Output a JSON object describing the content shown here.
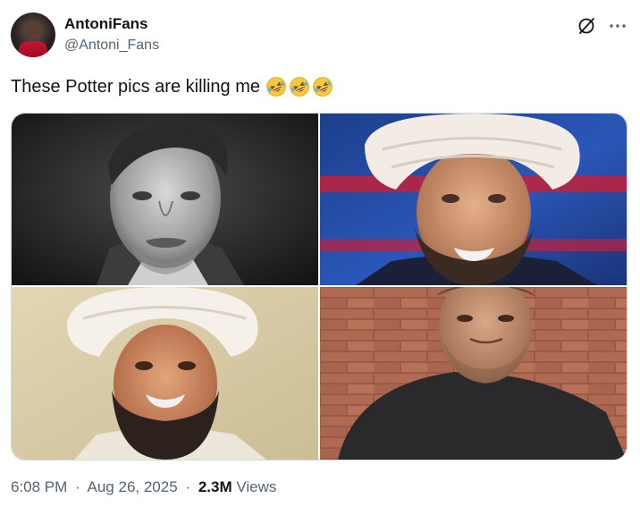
{
  "author": {
    "display_name": "AntoniFans",
    "handle": "@Antoni_Fans",
    "avatar_icon": "profile-avatar"
  },
  "header_actions": {
    "grok_icon": "grok-icon",
    "more_icon": "more-options-icon"
  },
  "post": {
    "text": "These Potter pics are killing me",
    "emojis": [
      "rolling-on-floor-laughing",
      "rolling-on-floor-laughing",
      "rolling-on-floor-laughing"
    ]
  },
  "media": {
    "photos": [
      {
        "name": "photo-1"
      },
      {
        "name": "photo-2"
      },
      {
        "name": "photo-3"
      },
      {
        "name": "photo-4"
      }
    ]
  },
  "footer": {
    "time": "6:08 PM",
    "separator": "·",
    "date": "Aug 26, 2025",
    "views_count": "2.3M",
    "views_label": "Views"
  },
  "colors": {
    "text_primary": "#0f1419",
    "text_secondary": "#536471",
    "border": "#cfd9de",
    "background": "#ffffff"
  }
}
